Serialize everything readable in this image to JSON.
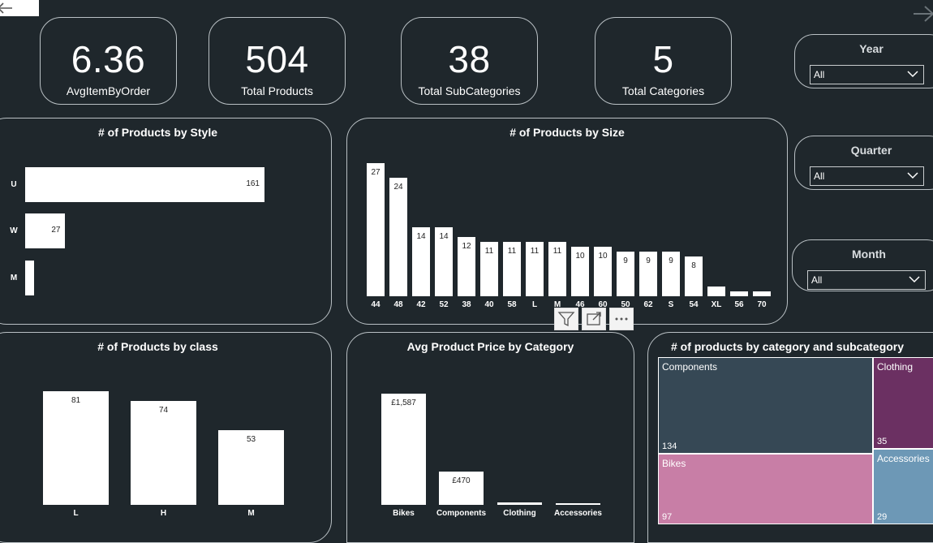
{
  "kpis": [
    {
      "value": "6.36",
      "label": "AvgItemByOrder"
    },
    {
      "value": "504",
      "label": "Total Products"
    },
    {
      "value": "38",
      "label": "Total SubCategories"
    },
    {
      "value": "5",
      "label": "Total Categories"
    }
  ],
  "slicers": [
    {
      "title": "Year",
      "value": "All"
    },
    {
      "title": "Quarter",
      "value": "All"
    },
    {
      "title": "Month",
      "value": "All"
    }
  ],
  "treemap": {
    "title": "# of products by category and subcategory",
    "cells": [
      {
        "label": "Components",
        "count": "134",
        "color": "#364855"
      },
      {
        "label": "Clothing",
        "count": "35",
        "color": "#6b3062"
      },
      {
        "label": "Bikes",
        "count": "97",
        "color": "#c87ea6"
      },
      {
        "label": "Accessories",
        "count": "29",
        "color": "#6d98b6"
      }
    ]
  },
  "chart_data": [
    {
      "type": "bar",
      "orientation": "horizontal",
      "title": "# of Products by Style",
      "categories": [
        "U",
        "W",
        "M"
      ],
      "values": [
        161,
        27,
        6
      ],
      "data_labels": [
        "161",
        "27",
        ""
      ]
    },
    {
      "type": "bar",
      "title": "# of Products by Size",
      "categories": [
        "44",
        "48",
        "42",
        "52",
        "38",
        "40",
        "58",
        "L",
        "M",
        "46",
        "60",
        "50",
        "62",
        "S",
        "54",
        "XL",
        "56",
        "70"
      ],
      "values": [
        27,
        24,
        14,
        14,
        12,
        11,
        11,
        11,
        11,
        10,
        10,
        9,
        9,
        9,
        8,
        2,
        1,
        1
      ],
      "data_labels": [
        "27",
        "24",
        "14",
        "14",
        "12",
        "11",
        "11",
        "11",
        "11",
        "10",
        "10",
        "9",
        "9",
        "9",
        "8",
        "",
        "",
        ""
      ]
    },
    {
      "type": "bar",
      "title": "# of Products by class",
      "categories": [
        "L",
        "H",
        "M"
      ],
      "values": [
        81,
        74,
        53
      ],
      "data_labels": [
        "81",
        "74",
        "53"
      ]
    },
    {
      "type": "bar",
      "title": "Avg Product Price by Category",
      "categories": [
        "Bikes",
        "Components",
        "Clothing",
        "Accessories"
      ],
      "values": [
        1587,
        470,
        30,
        20
      ],
      "data_labels": [
        "£1,587",
        "£470",
        "",
        ""
      ]
    }
  ],
  "icons": {
    "back": "arrow-left-icon",
    "forward": "arrow-right-icon",
    "filter": "filter-icon",
    "focus": "focus-mode-icon",
    "more": "more-options-icon",
    "chevron": "chevron-down-icon"
  }
}
